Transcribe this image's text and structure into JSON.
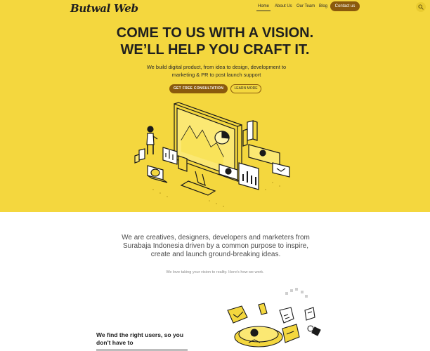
{
  "brand": {
    "logo": "Butwal Web"
  },
  "nav": {
    "items": [
      {
        "label": "Home",
        "active": true
      },
      {
        "label": "About Us"
      },
      {
        "label": "Our Team"
      },
      {
        "label": "Blog"
      }
    ],
    "contact_label": "Contact us",
    "search_icon": "search-icon"
  },
  "hero": {
    "title_line1": "COME TO US WITH A VISION.",
    "title_line2": "WE’LL HELP YOU CRAFT IT.",
    "subtitle": "We build digital product, from idea to design, development to marketing & PR to post launch support",
    "primary_button": "GET FREE CONSULTATION",
    "secondary_button": "LEARN MORE"
  },
  "intro": {
    "text": "We are creatives, designers, developers and marketers from Surabaja Indonesia driven by a common purpose to inspire, create and launch ground-breaking ideas.",
    "tagline": "We love taking your vision to reality. Here's how we work."
  },
  "feature": {
    "title": "We find the right users, so you don't have to"
  },
  "colors": {
    "hero_bg": "#f4d73e",
    "accent": "#8a5a0d",
    "text_dark": "#1f1f1f"
  }
}
